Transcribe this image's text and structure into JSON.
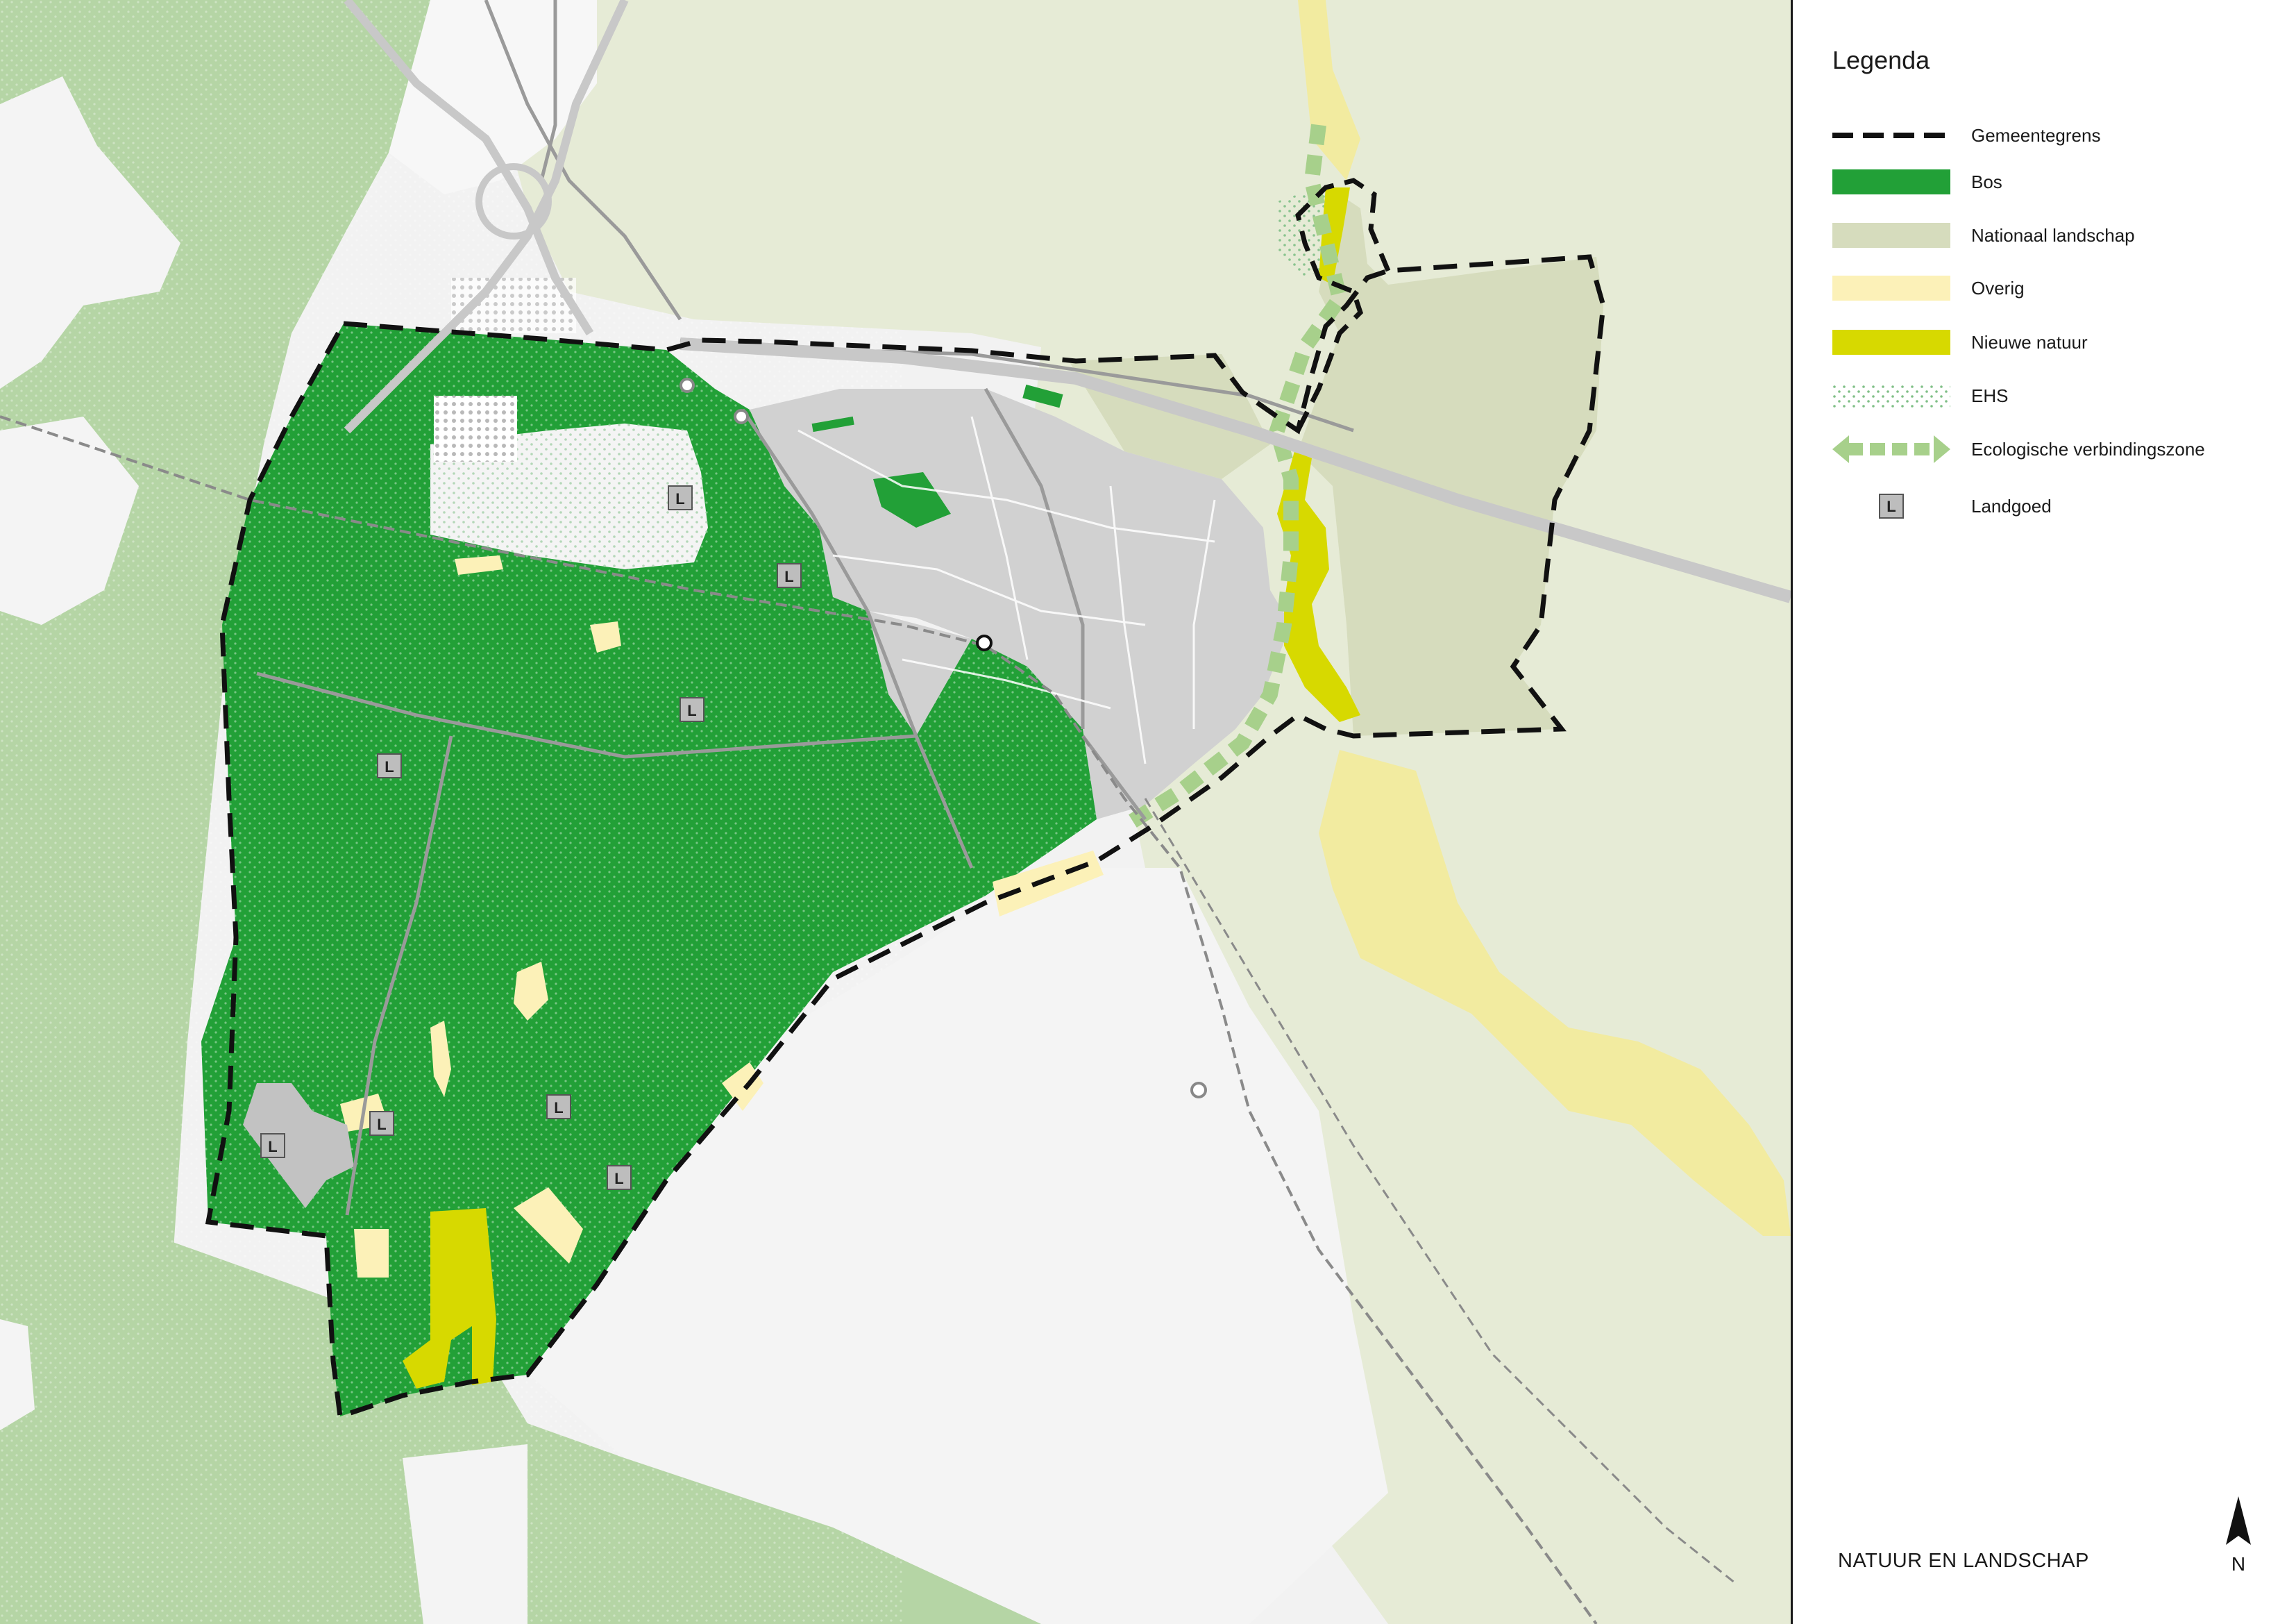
{
  "legend": {
    "title": "Legenda",
    "items": [
      {
        "key": "gemeentegrens",
        "label": "Gemeentegrens",
        "icon": "dashed-line-icon",
        "color": "#111111"
      },
      {
        "key": "bos",
        "label": "Bos",
        "icon": "bos-swatch-icon",
        "color": "#22a037"
      },
      {
        "key": "nationaal-landschap",
        "label": "Nationaal landschap",
        "icon": "nationaal-landschap-swatch-icon",
        "color": "#d6dcbd"
      },
      {
        "key": "overig",
        "label": "Overig",
        "icon": "overig-swatch-icon",
        "color": "#fcf1b8"
      },
      {
        "key": "nieuwe-natuur",
        "label": "Nieuwe natuur",
        "icon": "nieuwe-natuur-swatch-icon",
        "color": "#d7d900"
      },
      {
        "key": "ehs",
        "label": "EHS",
        "icon": "ehs-dot-pattern-icon",
        "color": "#9fd3a3"
      },
      {
        "key": "ecologische-verbindingszone",
        "label": "Ecologische verbindingszone",
        "icon": "ecological-zone-arrow-icon",
        "color": "#a7d08b"
      },
      {
        "key": "landgoed",
        "label": "Landgoed",
        "icon": "landgoed-icon",
        "color": "#bdbdbd",
        "marker": "L"
      }
    ]
  },
  "map": {
    "title": "NATUUR EN LANDSCHAP",
    "north_label": "N",
    "landgoed_marker": "L"
  }
}
